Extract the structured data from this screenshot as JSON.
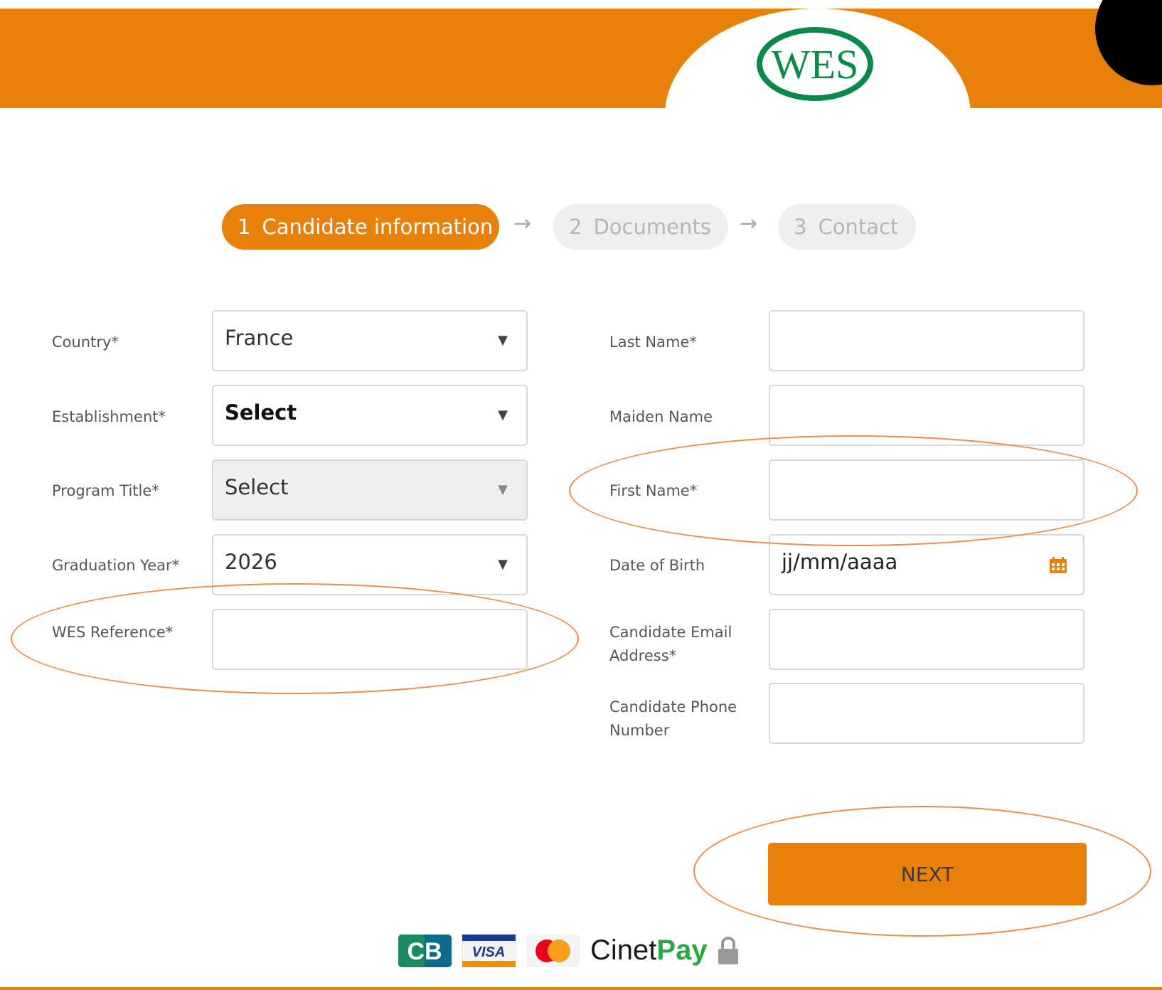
{
  "brand": {
    "logo_text": "WES",
    "accent": "#e8800a",
    "logo_green": "#0a8a4a"
  },
  "steps": [
    {
      "number": "1",
      "label": "Candidate information",
      "active": true
    },
    {
      "number": "2",
      "label": "Documents",
      "active": false
    },
    {
      "number": "3",
      "label": "Contact",
      "active": false
    }
  ],
  "step_arrow": "→",
  "form": {
    "country": {
      "label": "Country*",
      "value": "France"
    },
    "establishment": {
      "label": "Establishment*",
      "value": "Select"
    },
    "program_title": {
      "label": "Program Title*",
      "value": "Select"
    },
    "graduation_year": {
      "label": "Graduation Year*",
      "value": "2026"
    },
    "wes_reference": {
      "label": "WES Reference*",
      "value": ""
    },
    "last_name": {
      "label": "Last Name*",
      "value": ""
    },
    "maiden_name": {
      "label": "Maiden Name",
      "value": ""
    },
    "first_name": {
      "label": "First Name*",
      "value": ""
    },
    "date_of_birth": {
      "label": "Date of Birth",
      "placeholder": "jj/mm/aaaa"
    },
    "email": {
      "label_line1": "Candidate Email",
      "label_line2": "Address*",
      "value": ""
    },
    "phone": {
      "label_line1": "Candidate Phone",
      "label_line2": "Number",
      "value": ""
    }
  },
  "next_label": "NEXT",
  "payments": {
    "cb": "CB",
    "visa": "VISA",
    "cinet_a": "Cinet",
    "cinet_b": "Pay"
  }
}
